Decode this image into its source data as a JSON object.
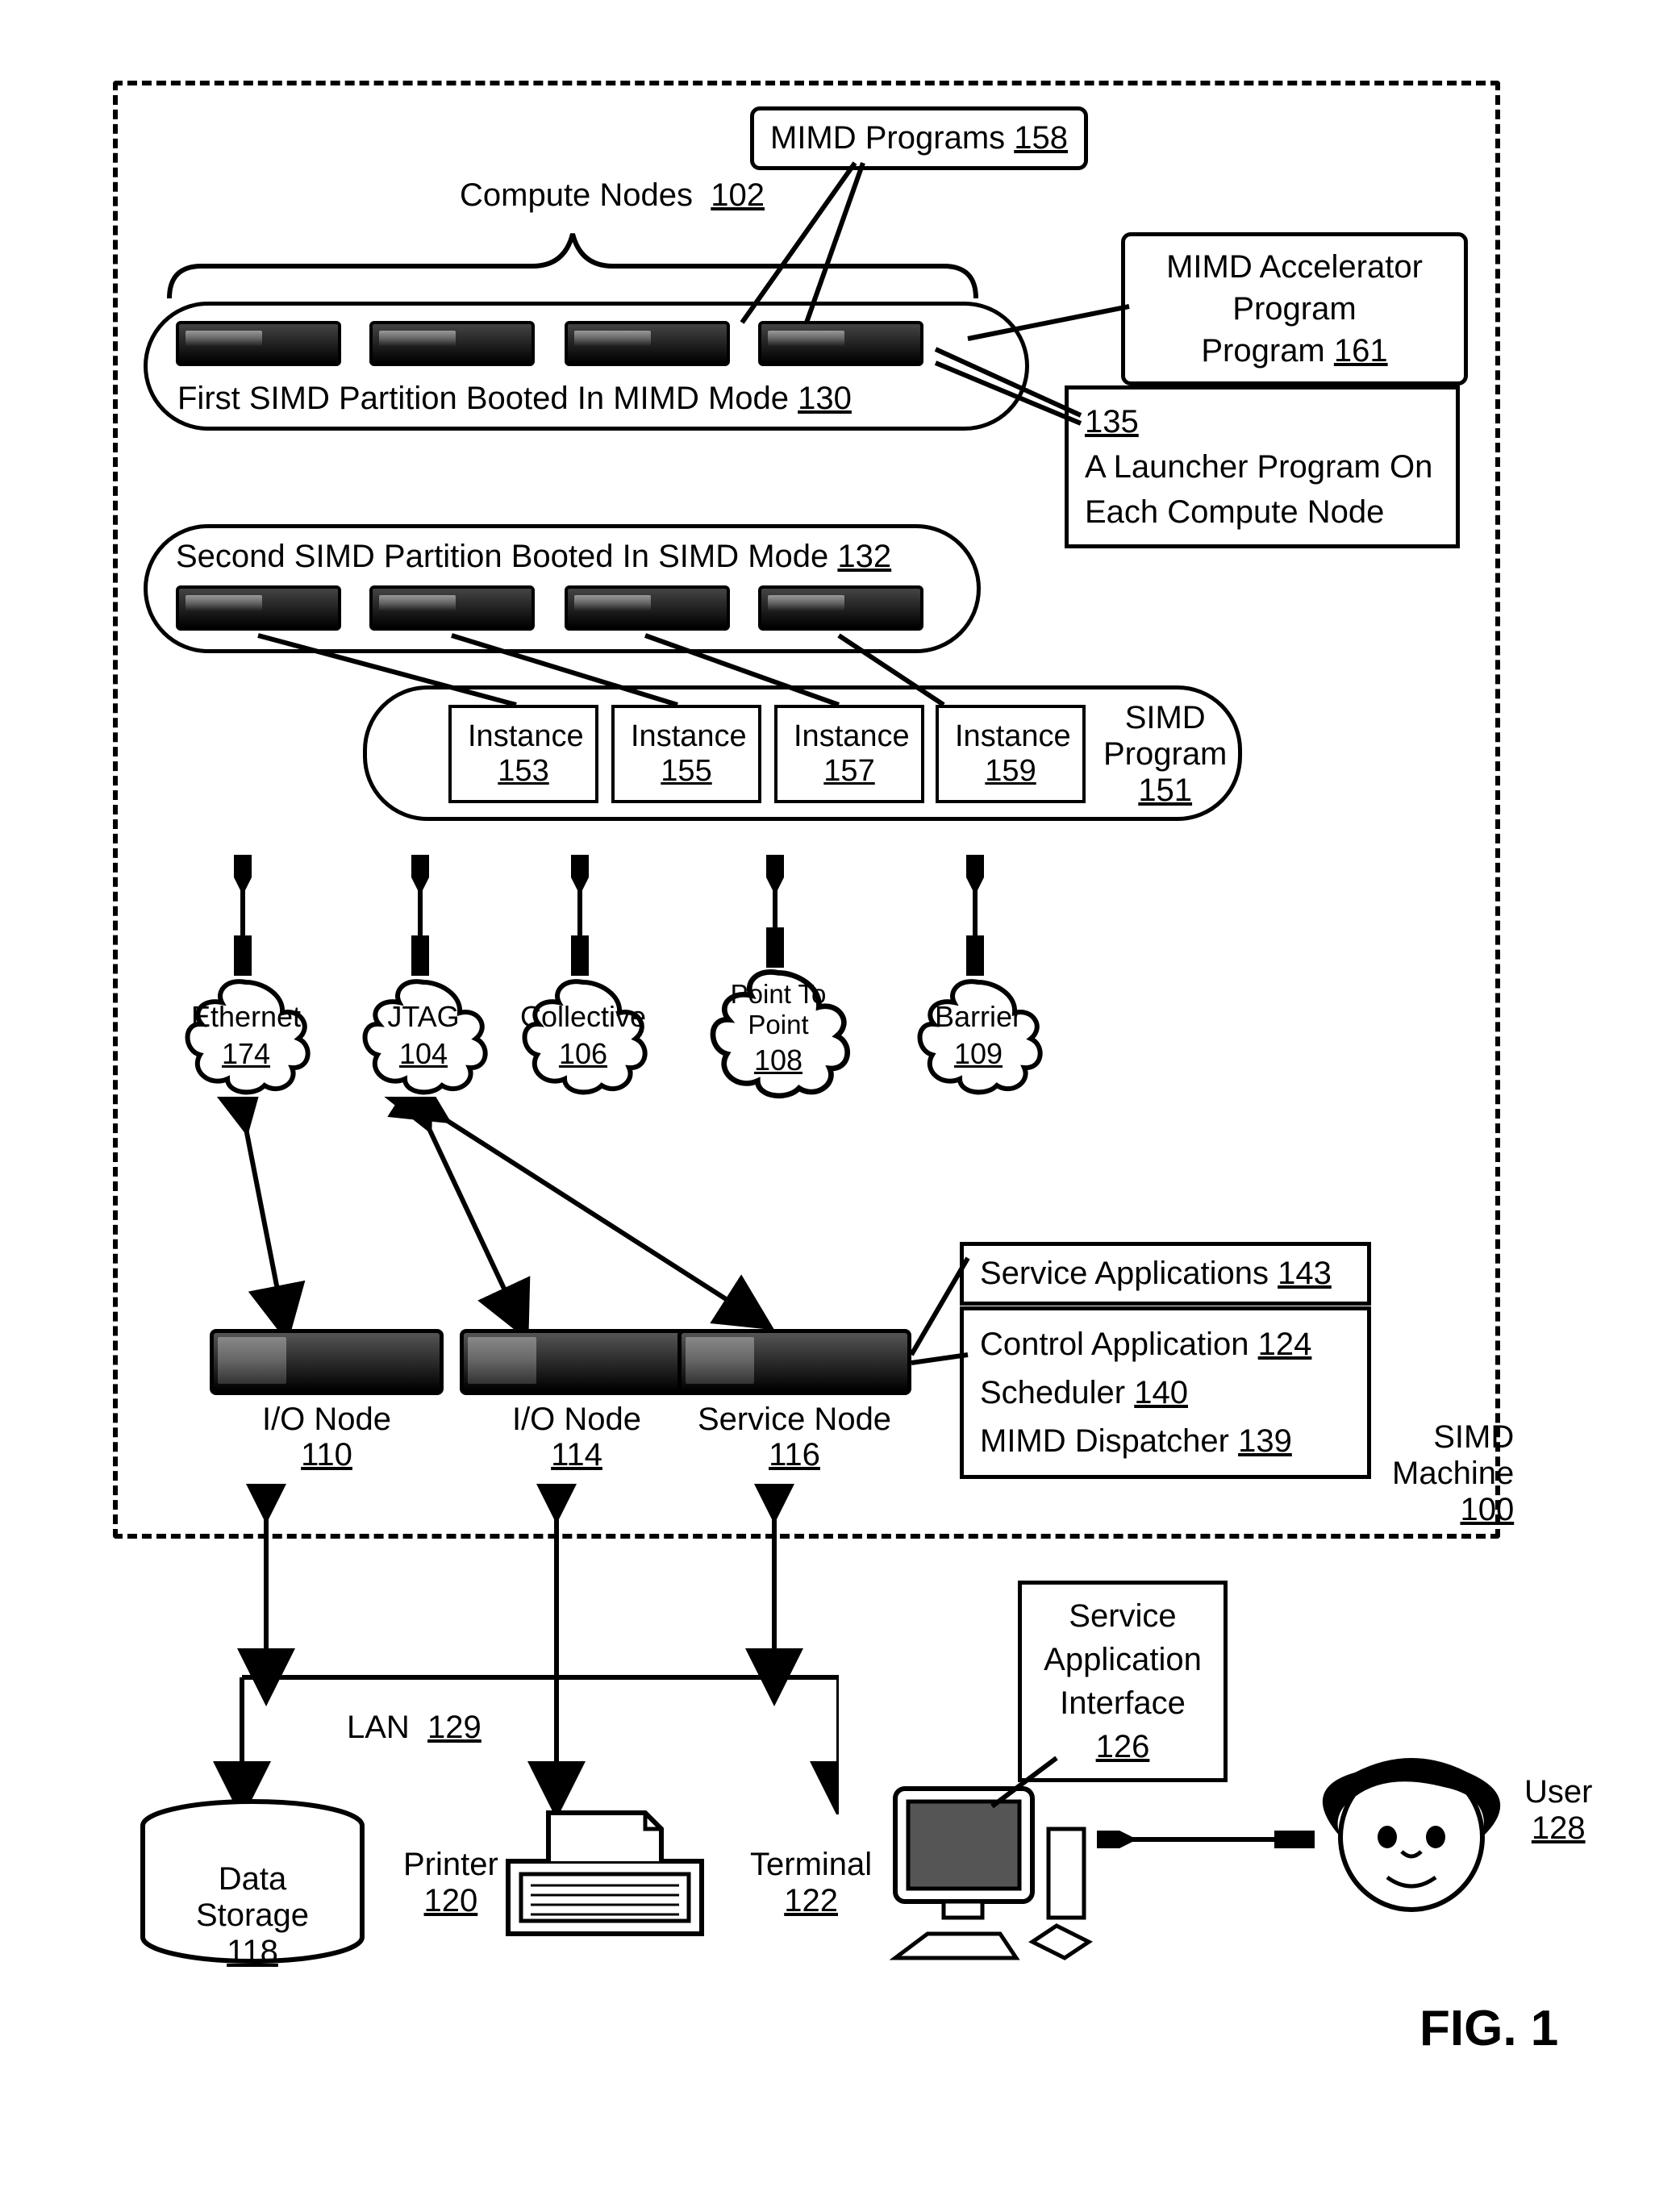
{
  "figure": "FIG. 1",
  "machine": {
    "label": "SIMD Machine",
    "num": "100"
  },
  "compute": {
    "label": "Compute Nodes",
    "num": "102"
  },
  "mimd_programs": {
    "label": "MIMD Programs",
    "num": "158"
  },
  "mimd_accel": {
    "label": "MIMD Accelerator Program",
    "num": "161"
  },
  "launcher": {
    "num": "135",
    "label": "A Launcher Program On Each Compute Node"
  },
  "partition1": {
    "label": "First SIMD Partition Booted In MIMD Mode",
    "num": "130"
  },
  "partition2": {
    "label": "Second SIMD Partition Booted In SIMD Mode",
    "num": "132"
  },
  "simd_program": {
    "label": "SIMD Program",
    "num": "151"
  },
  "instances": [
    {
      "label": "Instance",
      "num": "153"
    },
    {
      "label": "Instance",
      "num": "155"
    },
    {
      "label": "Instance",
      "num": "157"
    },
    {
      "label": "Instance",
      "num": "159"
    }
  ],
  "clouds": [
    {
      "label": "Ethernet",
      "num": "174"
    },
    {
      "label": "JTAG",
      "num": "104"
    },
    {
      "label": "Collective",
      "num": "106"
    },
    {
      "label": "Point To Point",
      "num": "108"
    },
    {
      "label": "Barrier",
      "num": "109"
    }
  ],
  "io1": {
    "label": "I/O Node",
    "num": "110"
  },
  "io2": {
    "label": "I/O Node",
    "num": "114"
  },
  "svc": {
    "label": "Service Node",
    "num": "116"
  },
  "svc_apps": {
    "label": "Service Applications",
    "num": "143"
  },
  "ctrl_app": {
    "label": "Control Application",
    "num": "124"
  },
  "scheduler": {
    "label": "Scheduler",
    "num": "140"
  },
  "dispatcher": {
    "label": "MIMD Dispatcher",
    "num": "139"
  },
  "svc_iface": {
    "label": "Service Application Interface",
    "num": "126"
  },
  "lan": {
    "label": "LAN",
    "num": "129"
  },
  "storage": {
    "label": "Data Storage",
    "num": "118"
  },
  "printer": {
    "label": "Printer",
    "num": "120"
  },
  "terminal": {
    "label": "Terminal",
    "num": "122"
  },
  "user": {
    "label": "User",
    "num": "128"
  }
}
